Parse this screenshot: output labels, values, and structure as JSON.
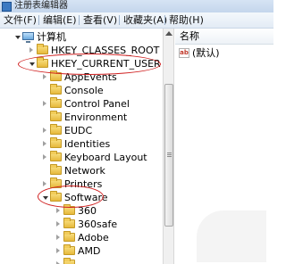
{
  "window": {
    "title": "注册表编辑器"
  },
  "menu": [
    "文件(F)",
    "编辑(E)",
    "查看(V)",
    "收藏夹(A)",
    "帮助(H)"
  ],
  "tree": {
    "root": "计算机",
    "hkcr": "HKEY_CLASSES_ROOT",
    "hkcu": "HKEY_CURRENT_USER",
    "hkcu_children": [
      "AppEvents",
      "Console",
      "Control Panel",
      "Environment",
      "EUDC",
      "Identities",
      "Keyboard Layout",
      "Network",
      "Printers",
      "Software"
    ],
    "software_children": [
      "360",
      "360safe",
      "Adobe",
      "AMD"
    ]
  },
  "values_pane": {
    "column_name": "名称",
    "rows": [
      {
        "icon": "ab",
        "name": "(默认)"
      }
    ]
  },
  "annotation_color": "#d02020"
}
